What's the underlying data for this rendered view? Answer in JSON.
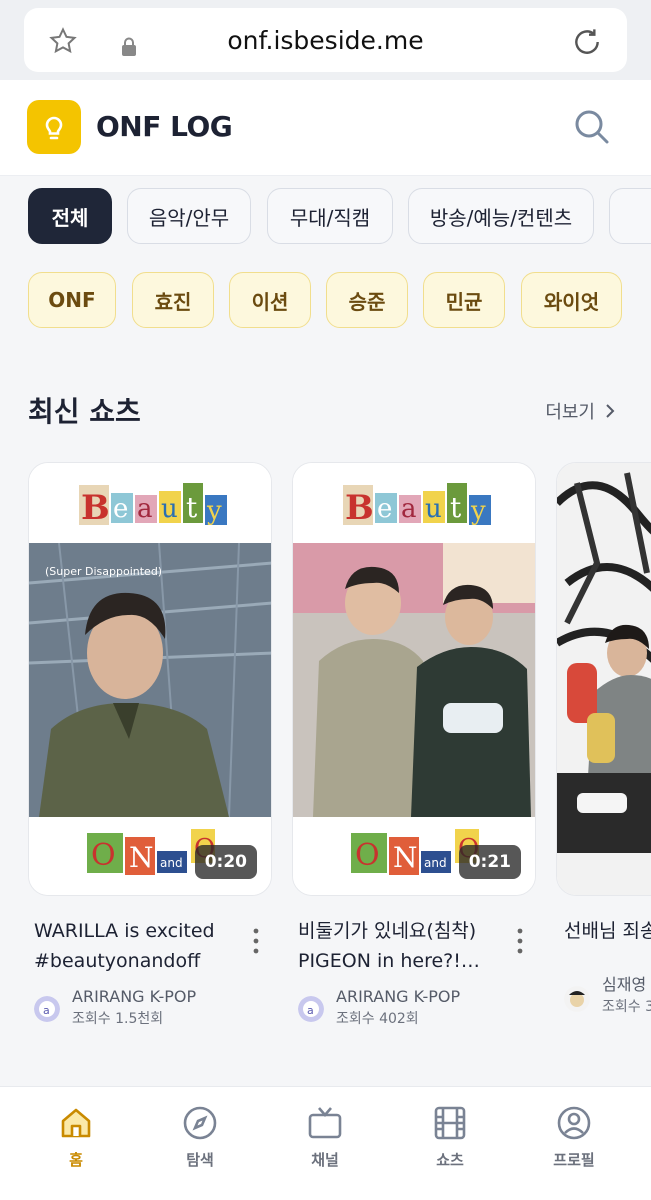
{
  "browser": {
    "url": "onf.isbeside.me"
  },
  "header": {
    "brand": "ONF LOG"
  },
  "categories": [
    {
      "label": "전체",
      "active": true
    },
    {
      "label": "음악/안무",
      "active": false
    },
    {
      "label": "무대/직캠",
      "active": false
    },
    {
      "label": "방송/예능/컨텐츠",
      "active": false
    }
  ],
  "members": [
    "ONF",
    "효진",
    "이션",
    "승준",
    "민균",
    "와이엇"
  ],
  "section": {
    "title": "최신 쇼츠",
    "more_label": "더보기"
  },
  "shorts": [
    {
      "title": "WARILLA is excited #beautyonandoff",
      "channel": "ARIRANG K-POP",
      "views": "조회수 1.5천회",
      "duration": "0:20"
    },
    {
      "title": "비둘기가 있네요(침착) PIGEON in here?!…",
      "channel": "ARIRANG K-POP",
      "views": "조회수 402회",
      "duration": "0:21"
    },
    {
      "title": "선배님 죄송",
      "channel": "심재영",
      "views": "조회수 3",
      "duration": ""
    }
  ],
  "nav": [
    {
      "label": "홈",
      "icon": "home-icon",
      "active": true
    },
    {
      "label": "탐색",
      "icon": "compass-icon",
      "active": false
    },
    {
      "label": "채널",
      "icon": "tv-icon",
      "active": false
    },
    {
      "label": "쇼츠",
      "icon": "film-icon",
      "active": false
    },
    {
      "label": "프로필",
      "icon": "user-icon",
      "active": false
    }
  ],
  "colors": {
    "accent": "#f4c400",
    "active_chip": "#1f2638",
    "nav_active": "#c98a00"
  }
}
